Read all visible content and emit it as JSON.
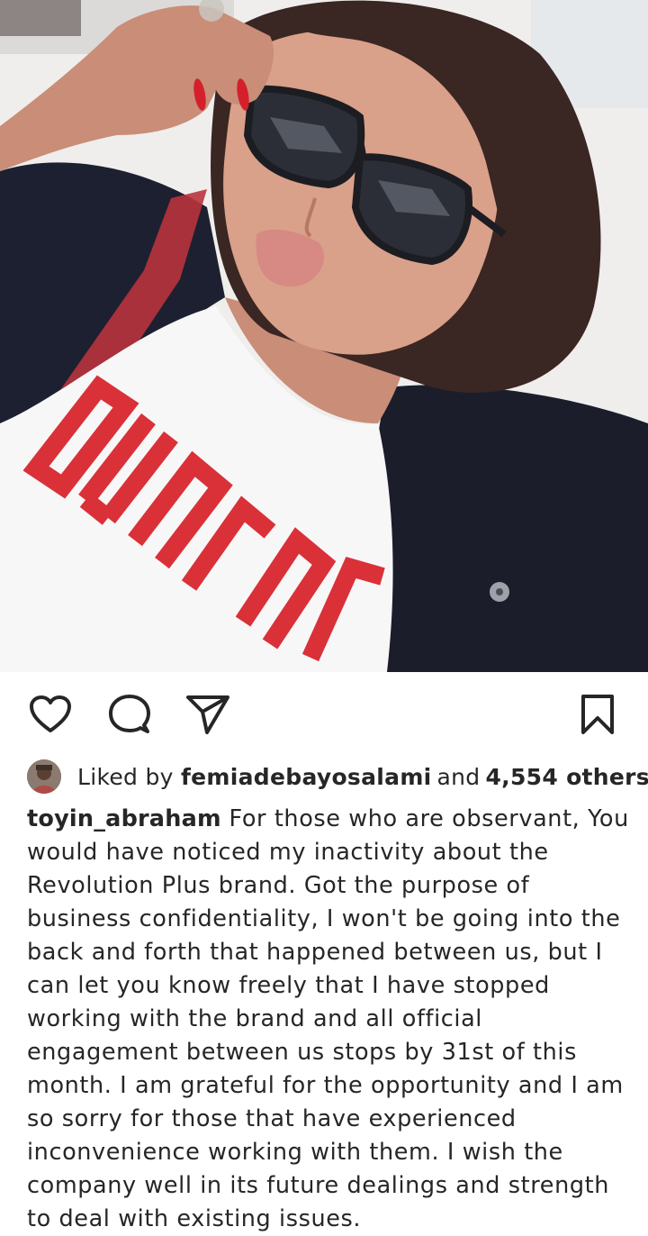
{
  "post": {
    "image_icon": "selfie-photo",
    "shirt_print": "OMUJAC"
  },
  "actions": {
    "like_icon": "heart-icon",
    "comment_icon": "comment-bubble-icon",
    "share_icon": "paper-plane-icon",
    "save_icon": "bookmark-icon"
  },
  "likes": {
    "prefix": "Liked by",
    "user": "femiadebayosalami",
    "joiner": "and",
    "others": "4,554 others"
  },
  "caption": {
    "username": "toyin_abraham",
    "text": "For those who are observant, You would have noticed my inactivity about the Revolution Plus brand. Got the purpose of business confidentiality, I won't be going into the back and forth that happened between us, but I can let you know freely that I have stopped working with the brand and all official engagement between us stops by 31st of this month. I am grateful for the opportunity and I am so sorry for those that have experienced inconvenience working with them. I wish the company well in its future dealings and strength to deal with existing issues."
  },
  "colors": {
    "text": "#262626",
    "shirt_print": "#d9272e",
    "jacket": "#1b1d2b",
    "hair": "#3a2622"
  }
}
